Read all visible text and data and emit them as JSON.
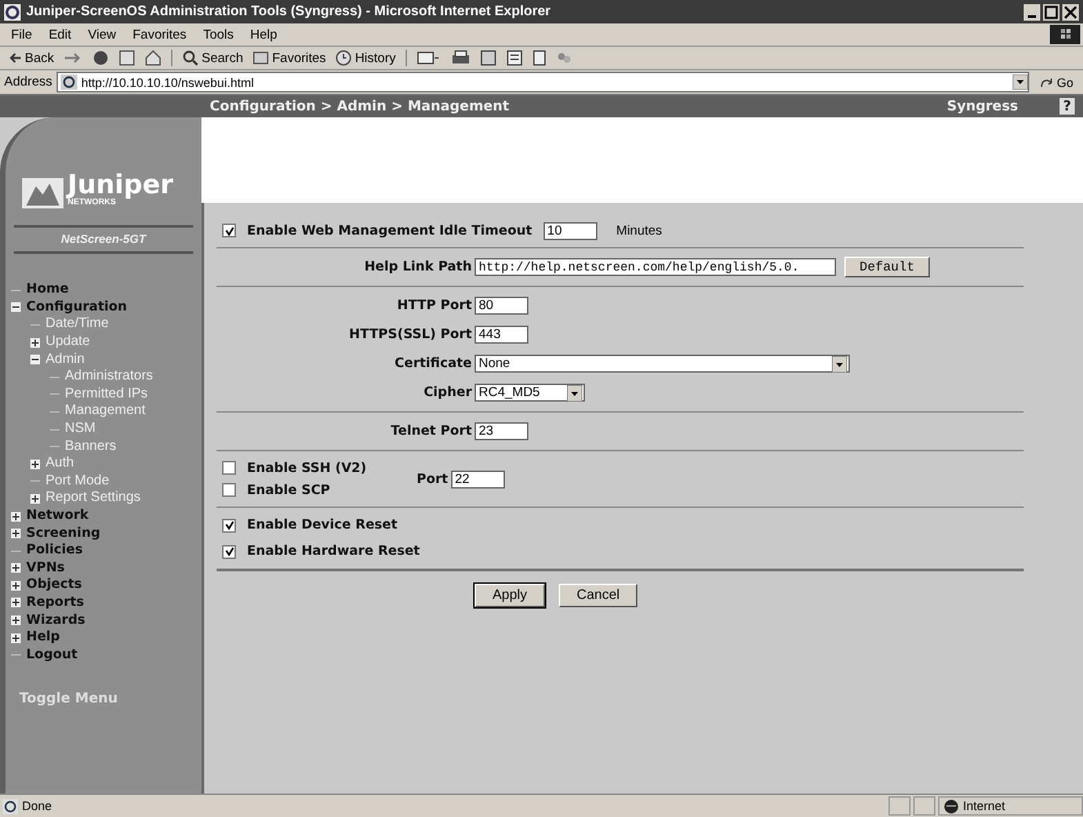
{
  "window": {
    "title": "Juniper-ScreenOS Administration Tools (Syngress) - Microsoft Internet Explorer"
  },
  "menu": [
    "File",
    "Edit",
    "View",
    "Favorites",
    "Tools",
    "Help"
  ],
  "toolbar": {
    "back": "Back",
    "search": "Search",
    "favorites": "Favorites",
    "history": "History"
  },
  "address": {
    "label": "Address",
    "url": "http://10.10.10.10/nswebui.html",
    "go": "Go"
  },
  "header": {
    "breadcrumb": "Configuration > Admin > Management",
    "brand": "Syngress",
    "help": "?"
  },
  "sidebar": {
    "logo": "Juniper",
    "logo_sub": "NETWORKS",
    "device": "NetScreen-5GT",
    "toggle": "Toggle Menu",
    "items": [
      {
        "label": "Home"
      },
      {
        "label": "Configuration",
        "expanded": true,
        "children": [
          {
            "label": "Date/Time"
          },
          {
            "label": "Update",
            "expanded": false
          },
          {
            "label": "Admin",
            "expanded": true,
            "children": [
              {
                "label": "Administrators"
              },
              {
                "label": "Permitted IPs"
              },
              {
                "label": "Management"
              },
              {
                "label": "NSM"
              },
              {
                "label": "Banners"
              }
            ]
          },
          {
            "label": "Auth",
            "expanded": false
          },
          {
            "label": "Port Mode"
          },
          {
            "label": "Report Settings",
            "expanded": false
          }
        ]
      },
      {
        "label": "Network",
        "expanded": false
      },
      {
        "label": "Screening",
        "expanded": false
      },
      {
        "label": "Policies"
      },
      {
        "label": "VPNs",
        "expanded": false
      },
      {
        "label": "Objects",
        "expanded": false
      },
      {
        "label": "Reports",
        "expanded": false
      },
      {
        "label": "Wizards",
        "expanded": false
      },
      {
        "label": "Help",
        "expanded": false
      },
      {
        "label": "Logout"
      }
    ]
  },
  "form": {
    "idle_timeout": {
      "label": "Enable Web Management Idle Timeout",
      "checked": true,
      "value": "10",
      "unit": "Minutes"
    },
    "help_link": {
      "label": "Help Link Path",
      "value": "http://help.netscreen.com/help/english/5.0.",
      "button": "Default"
    },
    "ports": [
      {
        "kind": "text",
        "label": "HTTP Port",
        "value": "80"
      },
      {
        "kind": "text",
        "label": "HTTPS(SSL) Port",
        "value": "443"
      },
      {
        "kind": "select",
        "label": "Certificate",
        "value": "None",
        "wide": true
      },
      {
        "kind": "select",
        "label": "Cipher",
        "value": "RC4_MD5",
        "wide": false
      }
    ],
    "telnet": {
      "label": "Telnet Port",
      "value": "23"
    },
    "ssh": {
      "options": [
        {
          "label": "Enable SSH (V2)",
          "checked": false
        },
        {
          "label": "Enable SCP",
          "checked": false
        }
      ],
      "port_label": "Port",
      "port": "22"
    },
    "resets": [
      {
        "label": "Enable Device Reset",
        "checked": true
      },
      {
        "label": "Enable Hardware Reset",
        "checked": true
      }
    ],
    "buttons": [
      "Apply",
      "Cancel"
    ]
  },
  "status": {
    "text": "Done",
    "zone": "Internet"
  }
}
